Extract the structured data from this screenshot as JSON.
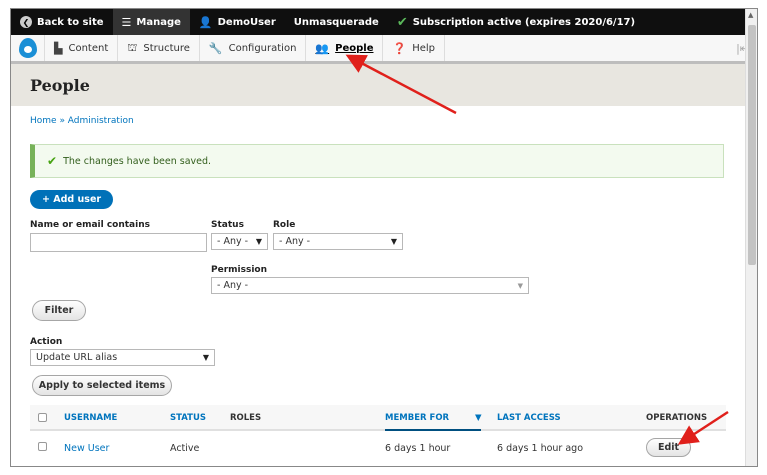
{
  "toolbar": {
    "back_label": "Back to site",
    "manage_label": "Manage",
    "user_label": "DemoUser",
    "unmasquerade_label": "Unmasquerade",
    "subscription_label": "Subscription active (expires 2020/6/17)"
  },
  "tray": {
    "items": [
      {
        "label": "Content",
        "icon": "file-icon"
      },
      {
        "label": "Structure",
        "icon": "structure-icon"
      },
      {
        "label": "Configuration",
        "icon": "wrench-icon"
      },
      {
        "label": "People",
        "icon": "people-icon"
      },
      {
        "label": "Help",
        "icon": "help-icon"
      }
    ]
  },
  "page": {
    "title": "People",
    "breadcrumb": "Home » Administration",
    "status_message": "The changes have been saved.",
    "add_user_label": "+ Add user"
  },
  "filters": {
    "name_label": "Name or email contains",
    "name_value": "",
    "status_label": "Status",
    "status_value": "- Any -",
    "role_label": "Role",
    "role_value": "- Any -",
    "permission_label": "Permission",
    "permission_value": "- Any -",
    "filter_button": "Filter"
  },
  "bulk": {
    "action_label": "Action",
    "action_value": "Update URL alias",
    "apply_button": "Apply to selected items"
  },
  "table": {
    "headers": {
      "username": "USERNAME",
      "status": "STATUS",
      "roles": "ROLES",
      "member_for": "MEMBER FOR",
      "last_access": "LAST ACCESS",
      "operations": "OPERATIONS"
    },
    "rows": [
      {
        "username": "New User",
        "status": "Active",
        "roles": "",
        "member_for": "6 days 1 hour",
        "last_access": "6 days 1 hour ago",
        "operation": "Edit"
      }
    ]
  },
  "colors": {
    "link": "#0074bd",
    "toolbar_bg": "#0f0f0f",
    "annotation_arrow": "#e0201b",
    "success_green": "#77b259"
  }
}
